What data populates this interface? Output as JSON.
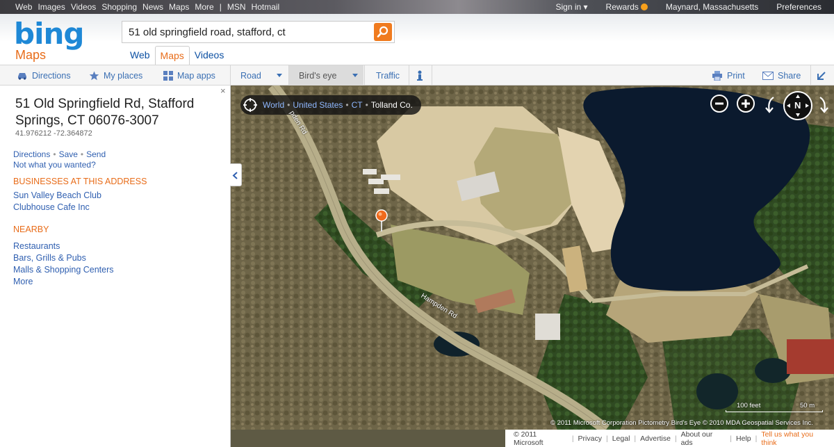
{
  "topbar": {
    "left_links": [
      "Web",
      "Images",
      "Videos",
      "Shopping",
      "News",
      "Maps",
      "More"
    ],
    "msn": "MSN",
    "hotmail": "Hotmail",
    "sign_in": "Sign in ▾",
    "rewards": "Rewards",
    "location": "Maynard, Massachusetts",
    "preferences": "Preferences"
  },
  "header": {
    "logo": "bing",
    "section": "Maps",
    "search_value": "51 old springfield road, stafford, ct",
    "tabs": [
      "Web",
      "Maps",
      "Videos"
    ],
    "active_tab": "Maps"
  },
  "toolbar": {
    "directions": "Directions",
    "my_places": "My places",
    "map_apps": "Map apps",
    "road": "Road",
    "birds_eye": "Bird's eye",
    "traffic": "Traffic",
    "print": "Print",
    "share": "Share"
  },
  "sidebar": {
    "close": "×",
    "address_title": "51 Old Springfield Rd, Stafford Springs, CT 06076-3007",
    "coords": "41.976212 -72.364872",
    "actions": [
      "Directions",
      "Save",
      "Send"
    ],
    "not_wanted": "Not what you wanted?",
    "businesses_heading": "BUSINESSES AT THIS ADDRESS",
    "businesses": [
      "Sun Valley Beach Club",
      "Clubhouse Cafe Inc"
    ],
    "nearby_heading": "NEARBY",
    "nearby": [
      "Restaurants",
      "Bars, Grills & Pubs",
      "Malls & Shopping Centers",
      "More"
    ]
  },
  "map": {
    "breadcrumb": [
      "World",
      "United States",
      "CT"
    ],
    "breadcrumb_current": "Tolland Co.",
    "compass_label": "N",
    "road_label_1": "Hampden Rd",
    "road_label_2": "pden Rd",
    "attribution": "© 2011 Microsoft Corporation   Pictometry Bird's Eye © 2010 MDA Geospatial Services Inc.",
    "scale_feet": "100 feet",
    "scale_m": "50 m"
  },
  "footer": {
    "copyright": "© 2011 Microsoft",
    "links": [
      "Privacy",
      "Legal",
      "Advertise",
      "About our ads",
      "Help"
    ],
    "tell": "Tell us what you think"
  },
  "colors": {
    "accent_orange": "#e86c19",
    "link_blue": "#2f5fb0",
    "bing_blue": "#1e88d6",
    "water": "#0a1a2e"
  }
}
